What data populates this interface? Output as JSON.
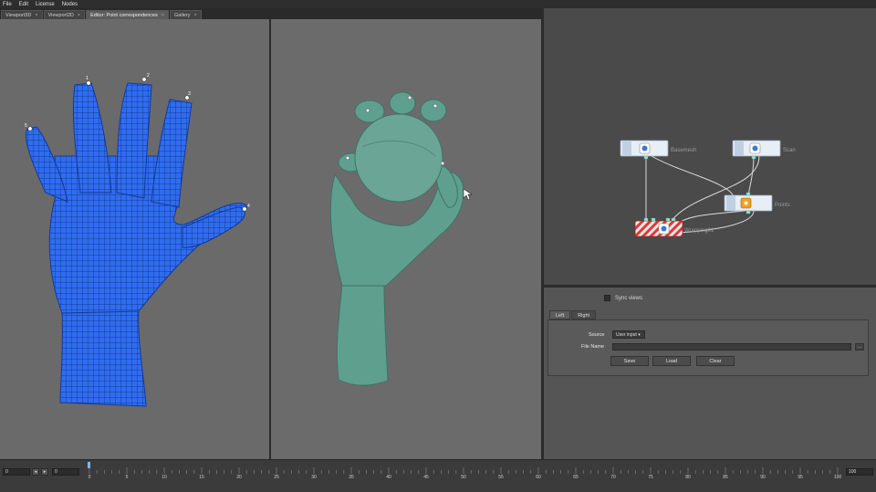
{
  "menu": [
    "File",
    "Edit",
    "License",
    "Nodes"
  ],
  "tabs": [
    {
      "label": "Viewport3D",
      "close": "×"
    },
    {
      "label": "Viewport2D",
      "close": "×"
    },
    {
      "label": "Editor: Point correspondences",
      "close": "×"
    },
    {
      "label": "Gallery",
      "close": "×"
    }
  ],
  "viewports": {
    "left_point_labels": [
      "5",
      "1",
      "2",
      "3",
      "4"
    ]
  },
  "node_graph": {
    "nodes": [
      {
        "label": "Basemesh"
      },
      {
        "label": "Scan"
      },
      {
        "label": "Points"
      },
      {
        "label": "Wrapping01"
      }
    ]
  },
  "properties": {
    "sync_label": "Sync views",
    "sub_tabs": [
      "Left",
      "Right"
    ],
    "source_label": "Source",
    "source_value": "User input",
    "file_name_label": "File Name",
    "file_name_value": "",
    "browse_label": "...",
    "save_label": "Save",
    "load_label": "Load",
    "clear_label": "Clear"
  },
  "timeline": {
    "start_value": "0",
    "current_value": "0",
    "end_value": "100",
    "prev_glyph": "◂",
    "next_glyph": "▸",
    "ticks": [
      "0",
      "5",
      "10",
      "15",
      "20",
      "25",
      "30",
      "35",
      "40",
      "45",
      "50",
      "55",
      "60",
      "65",
      "70",
      "75",
      "80",
      "85",
      "90",
      "95",
      "100"
    ]
  },
  "colors": {
    "blue_mesh": "#2f6cf0",
    "teal_mesh": "#5f9f8e",
    "node_active": "#e03838",
    "node_gold": "#f0a020"
  }
}
